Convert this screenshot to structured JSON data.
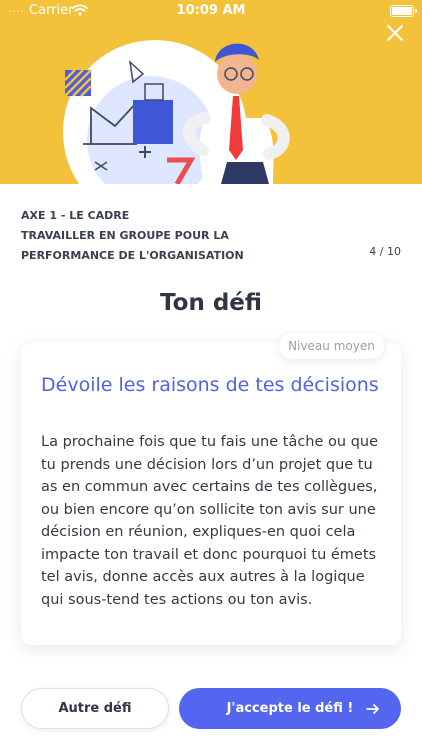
{
  "status_bar": {
    "signal": "....",
    "carrier": "Carrier",
    "time": "10:09 AM"
  },
  "header": {
    "close_icon": "close-icon",
    "illustration": "businessman-with-charts-illustration",
    "background_color": "#f3c13a"
  },
  "meta": {
    "axis": "AXE 1 - LE CADRE",
    "theme": "TRAVAILLER EN GROUPE POUR LA PERFORMANCE DE L'ORGANISATION",
    "progress": "4 / 10",
    "progress_current": 4,
    "progress_total": 10
  },
  "challenge": {
    "heading": "Ton défi",
    "level": "Niveau moyen",
    "title": "Dévoile les raisons de tes décisions",
    "body": "La prochaine fois que tu fais une tâche ou que tu prends une décision lors d’un projet que tu as en commun avec certains de tes collègues, ou bien encore qu’on sollicite ton avis sur une décision en réunion, expliques-en quoi cela impacte ton travail et donc pourquoi tu émets tel avis, donne accès aux autres à la logique qui sous-tend tes actions ou ton avis."
  },
  "actions": {
    "other_label": "Autre défi",
    "accept_label": "J'accepte le défi !",
    "accept_icon": "arrow-right-icon",
    "accent_color": "#5466ef"
  }
}
